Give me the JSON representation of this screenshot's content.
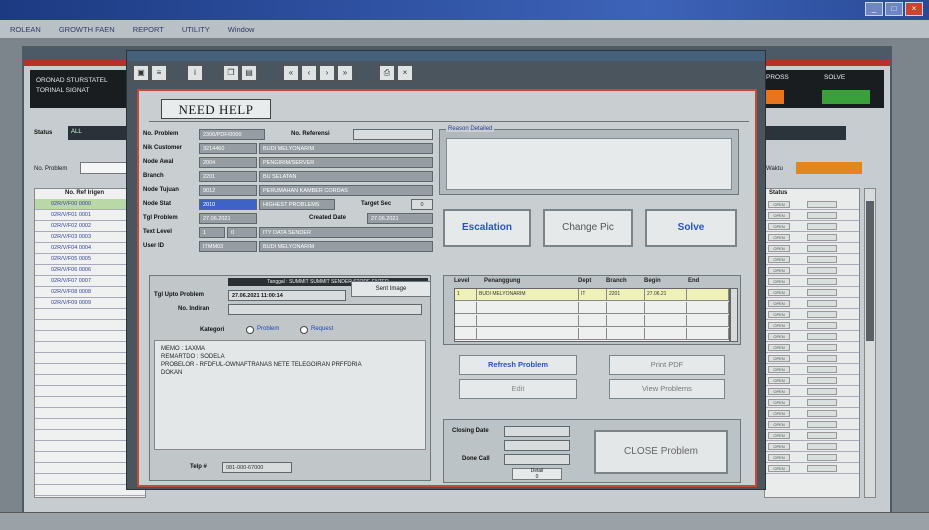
{
  "app": {
    "title": "",
    "menu": [
      "ROLEAN",
      "GROWTH FAEN",
      "REPORT",
      "UTILITY",
      "Window"
    ]
  },
  "background_app": {
    "left_header_lines": [
      "ORONAD STURSTATEL",
      "TORINAL SIGNAT"
    ],
    "status_label": "Status",
    "status_value": "ALL",
    "problem_label": "No. Problem",
    "table_header": "No. Ref Irigen",
    "rows": [
      "02R/V/F00 0000",
      "02R/V/F01 0001",
      "02R/V/F02 0002",
      "02R/V/F03 0003",
      "02R/V/F04 0004",
      "02R/V/F05 0005",
      "02R/V/F06 0006",
      "02R/V/F07 0007",
      "02R/V/F08 0008",
      "02R/V/F09 0009"
    ],
    "right_header": [
      "PROSS",
      "SOLVE"
    ],
    "right_label": "Waktu",
    "right_col_header": "Status",
    "right_rows": [
      "OPEN",
      "OPEN",
      "OPEN",
      "OPEN",
      "OPEN",
      "OPEN",
      "OPEN",
      "OPEN",
      "OPEN",
      "OPEN",
      "OPEN",
      "OPEN",
      "OPEN",
      "OPEN",
      "OPEN",
      "OPEN",
      "OPEN",
      "OPEN",
      "OPEN",
      "OPEN",
      "OPEN",
      "OPEN",
      "OPEN",
      "OPEN",
      "OPEN"
    ]
  },
  "dialog": {
    "heading": "NEED HELP",
    "toolbar_icons": [
      "save-icon",
      "list-icon",
      "info-icon",
      "copy-icon",
      "paste-icon",
      "first-icon",
      "prev-icon",
      "next-icon",
      "last-icon",
      "print-icon",
      "close-icon"
    ],
    "form": {
      "no_problem_label": "No. Problem",
      "no_problem_value": "2306/PDF/0000",
      "no_referensi_label": "No. Referensi",
      "no_referensi_value": "",
      "nik_customer_label": "Nik Customer",
      "nik_customer_value": "3214460",
      "nik_customer_name": "BUDI MELYONARIM",
      "node_awal_label": "Node Awal",
      "node_awal_code": "2004",
      "node_awal_name": "PENGIRIM/SERVER",
      "branch_label": "Branch",
      "branch_code": "2201",
      "branch_name": "BU SELATAN",
      "node_tujuan_label": "Node Tujuan",
      "node_tujuan_code": "9012",
      "node_tujuan_name": "PERUMAHAN KAMBER CORDAS",
      "node_stat_label": "Node Stat",
      "node_stat_code": "2010",
      "node_stat_name": "HIGHEST PROBLEMS",
      "target_sec_label": "Target Sec",
      "target_sec_value": "0",
      "tgl_problem_label": "Tgl Problem",
      "tgl_problem_value": "27.06.2021",
      "created_date_label": "Created Date",
      "created_date_value": "27.06.2021",
      "text_level_label": "Text Level",
      "text_level_code": "1",
      "text_level_sub": "0",
      "text_level_name": "ITY DATA SENDER",
      "user_id_label": "User ID",
      "user_id_value": "ITMM03",
      "user_id_name": "BUDI MELYONARIM"
    },
    "reason": {
      "legend": "Reason Detailed",
      "text": ""
    },
    "buttons": {
      "escalation": "Escalation",
      "change_pic": "Change Pic",
      "solve": "Solve",
      "refresh_problem": "Refresh Problem",
      "edit": "Edit",
      "print_pdf": "Print PDF",
      "view_problems": "View Problems",
      "close_problem": "CLOSE Problem",
      "sent_image": "Sent Image",
      "detail": "Detail"
    },
    "lower_left": {
      "dark_header": "Tanggal : SUMMIT SUMMIT SENDER STORE ENTER",
      "tgl_upto_label": "Tgl Upto Problem",
      "tgl_upto_value": "27.06.2021 11:00:14",
      "no_indiran_label": "No. Indiran",
      "kategori_label": "Kategori",
      "radio_problem": "Problem",
      "radio_request": "Request",
      "notes": [
        "MEMO : 1AXMA",
        "REMARTDO : SODELA",
        "PROBELOR - RFDFUL-OWNAFTRANAS     NETE TELEGOIRAN PRFFDRIA",
        "DOKAN"
      ],
      "telp_label": "Telp #",
      "telp_value": "081-000-67000"
    },
    "level_table": {
      "headers": [
        "Level",
        "Penanggung",
        "Dept",
        "Branch",
        "Begin",
        "End"
      ],
      "rows": [
        [
          "1",
          "BUDI MELYONARIM",
          "IT",
          "2201",
          "27.06.21",
          ""
        ],
        [
          "",
          "",
          "",
          "",
          "",
          ""
        ],
        [
          "",
          "",
          "",
          "",
          "",
          ""
        ],
        [
          "",
          "",
          "",
          "",
          "",
          ""
        ]
      ]
    },
    "closing": {
      "closing_date_label": "Closing Date",
      "done_call_label": "Done Call",
      "detail_value": "0"
    }
  },
  "colors": {
    "accent_red": "#c24b38",
    "escalation_blue": "#2654c2",
    "status_orange": "#e8741e",
    "status_green": "#3aa13a"
  }
}
